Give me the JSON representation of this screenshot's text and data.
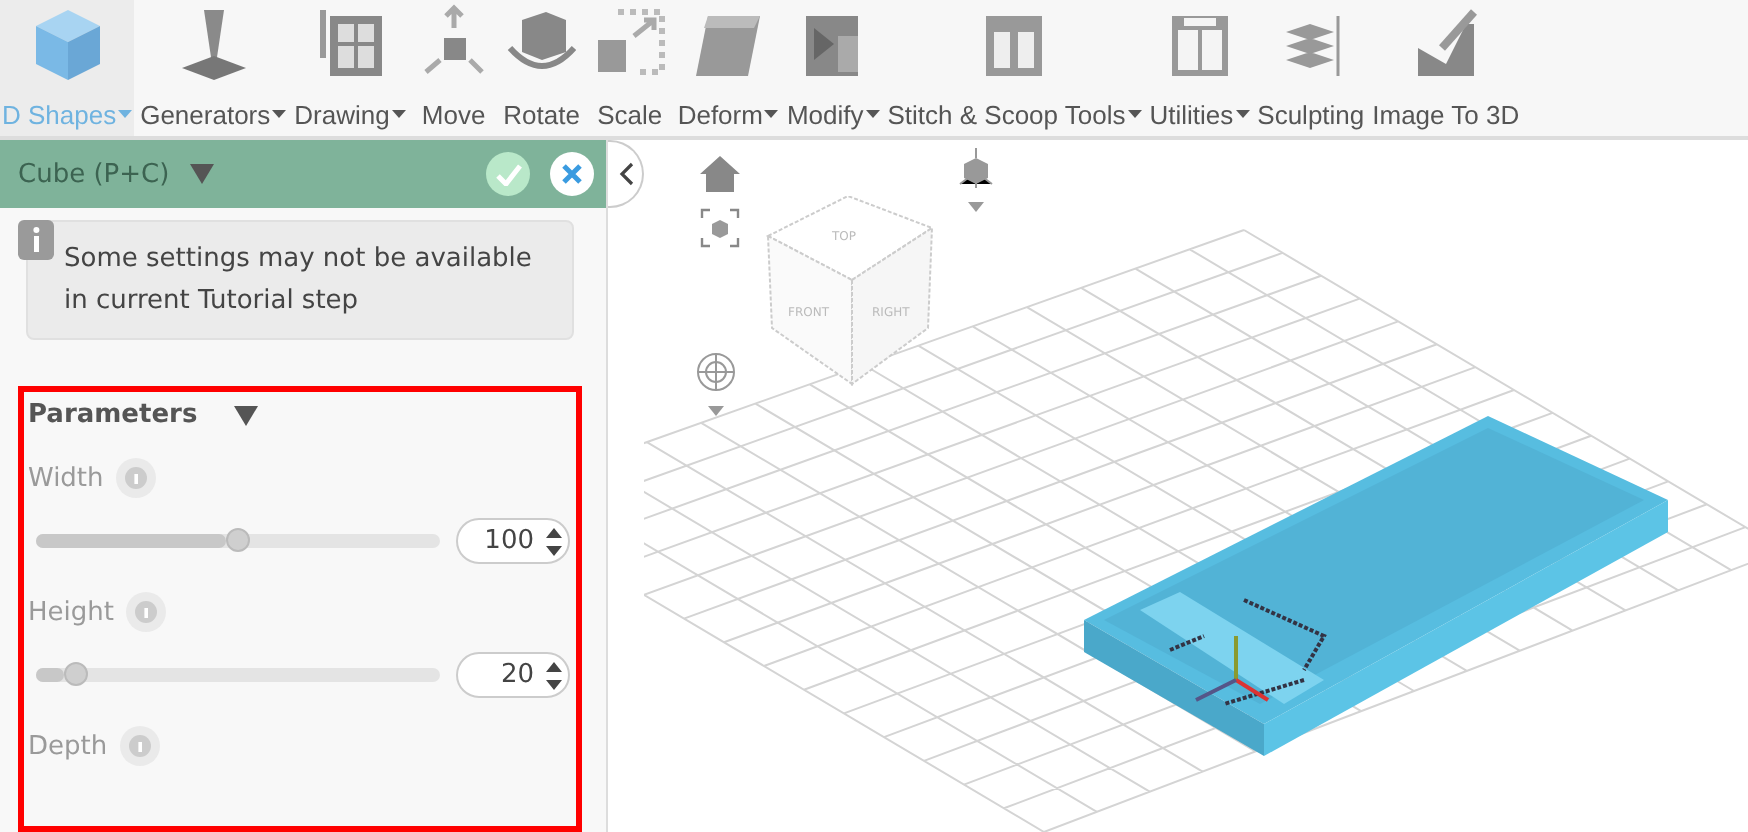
{
  "toolbar": {
    "items": [
      {
        "label": "D Shapes",
        "dropdown": true,
        "selected": true
      },
      {
        "label": "Generators",
        "dropdown": true,
        "selected": false
      },
      {
        "label": "Drawing",
        "dropdown": true,
        "selected": false
      },
      {
        "label": "Move",
        "dropdown": false,
        "selected": false
      },
      {
        "label": "Rotate",
        "dropdown": false,
        "selected": false
      },
      {
        "label": "Scale",
        "dropdown": false,
        "selected": false
      },
      {
        "label": "Deform",
        "dropdown": true,
        "selected": false
      },
      {
        "label": "Modify",
        "dropdown": true,
        "selected": false
      },
      {
        "label": "Stitch & Scoop Tools",
        "dropdown": true,
        "selected": false
      },
      {
        "label": "Utilities",
        "dropdown": true,
        "selected": false
      },
      {
        "label": "Sculpting",
        "dropdown": false,
        "selected": false
      },
      {
        "label": "Image To 3D",
        "dropdown": false,
        "selected": false
      }
    ]
  },
  "panel": {
    "title": "Cube (P+C)",
    "notice": "Some settings may not be available in current Tutorial step",
    "section": {
      "title": "Parameters",
      "highlighted": true,
      "params": [
        {
          "label": "Width",
          "level": 0.5,
          "value": "100",
          "disabled": true
        },
        {
          "label": "Height",
          "level": 0.1,
          "value": "20",
          "disabled": true
        },
        {
          "label": "Depth",
          "disabled": true
        }
      ]
    }
  },
  "viewport": {
    "view_cube": [
      "TOP",
      "FRONT",
      "RIGHT"
    ]
  }
}
